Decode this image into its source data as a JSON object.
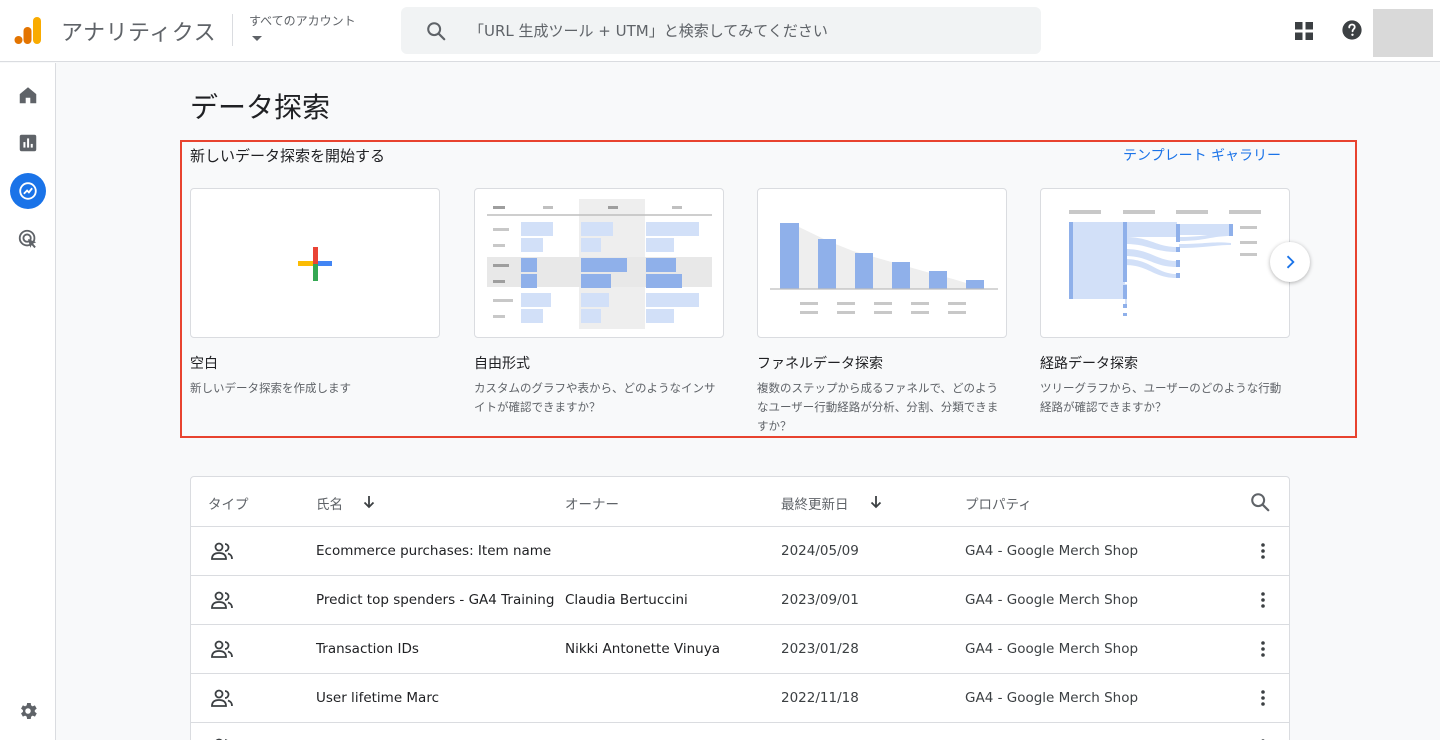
{
  "header": {
    "app_title": "アナリティクス",
    "account_label": "すべてのアカウント",
    "search_placeholder": "「URL 生成ツール + UTM」と検索してみてください"
  },
  "icons": {
    "logo": "analytics-logo",
    "search": "search-icon",
    "apps": "apps-icon",
    "help": "help-icon",
    "nav": [
      "home-icon",
      "reports-icon",
      "explore-icon",
      "advertising-icon"
    ],
    "settings": "gear-icon"
  },
  "colors": {
    "accent": "#1a73e8",
    "highlight_border": "#e8432f",
    "thumb_blue": "#8fb0ea",
    "thumb_light": "#d2e0f8"
  },
  "page": {
    "title": "データ探索"
  },
  "start_section": {
    "title": "新しいデータ探索を開始する",
    "gallery_link": "テンプレート ギャラリー",
    "cards": [
      {
        "title": "空白",
        "desc": "新しいデータ探索を作成します"
      },
      {
        "title": "自由形式",
        "desc": "カスタムのグラフや表から、どのようなインサイトが確認できますか？"
      },
      {
        "title": "ファネルデータ探索",
        "desc": "複数のステップから成るファネルで、どのようなユーザー行動経路が分析、分割、分類できますか？"
      },
      {
        "title": "経路データ探索",
        "desc": "ツリーグラフから、ユーザーのどのような行動経路が確認できますか？"
      }
    ]
  },
  "table": {
    "headers": {
      "type": "タイプ",
      "name": "氏名",
      "owner": "オーナー",
      "updated": "最終更新日",
      "property": "プロパティ"
    },
    "rows": [
      {
        "name": "Ecommerce purchases: Item name",
        "owner": "",
        "updated": "2024/05/09",
        "property": "GA4 - Google Merch Shop"
      },
      {
        "name": "Predict top spenders - GA4 Training",
        "owner": "Claudia Bertuccini",
        "updated": "2023/09/01",
        "property": "GA4 - Google Merch Shop"
      },
      {
        "name": "Transaction IDs",
        "owner": "Nikki Antonette Vinuya",
        "updated": "2023/01/28",
        "property": "GA4 - Google Merch Shop"
      },
      {
        "name": "User lifetime Marc",
        "owner": "",
        "updated": "2022/11/18",
        "property": "GA4 - Google Merch Shop"
      }
    ]
  }
}
